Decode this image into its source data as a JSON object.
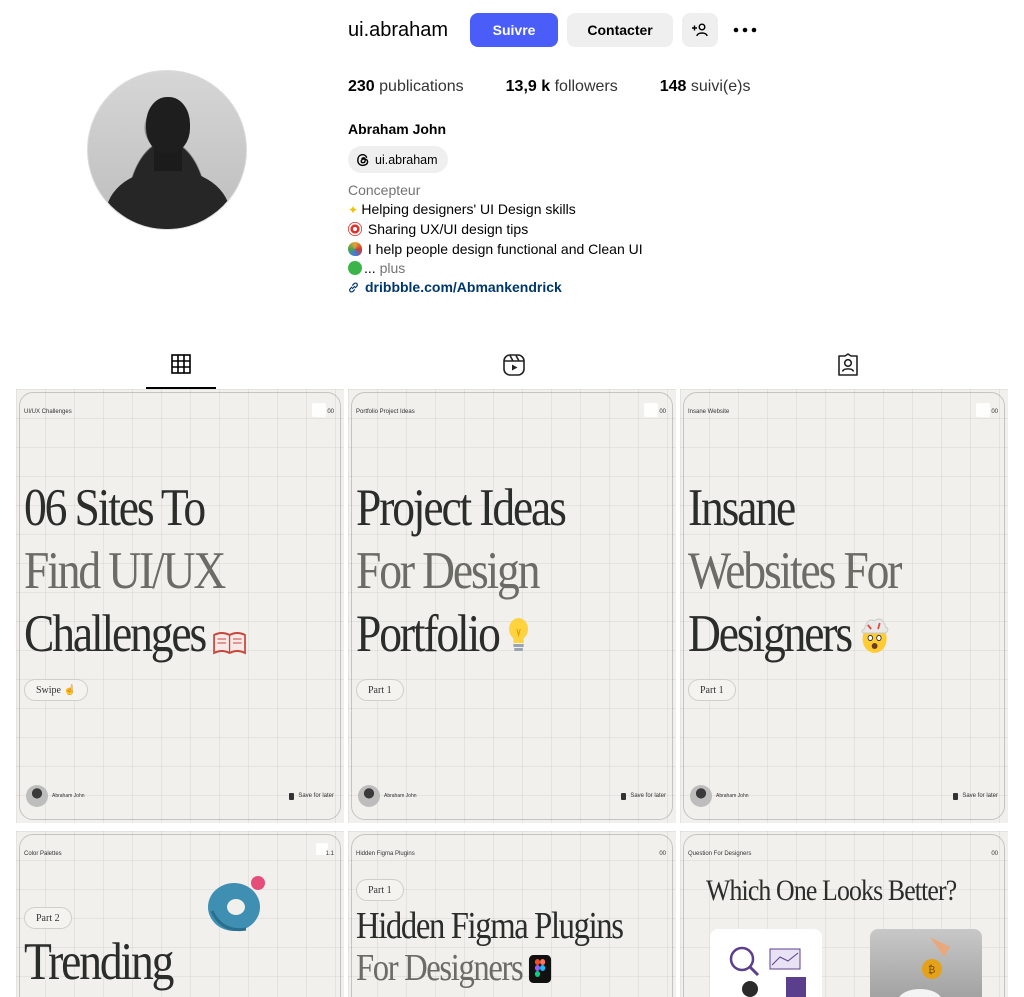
{
  "profile": {
    "username": "ui.abraham",
    "follow_label": "Suivre",
    "contact_label": "Contacter",
    "add_user_icon": "add-user-icon",
    "more_icon": "more-icon",
    "stats": {
      "posts_count": "230",
      "posts_label": "publications",
      "followers_count": "13,9 k",
      "followers_label": "followers",
      "following_count": "148",
      "following_label": "suivi(e)s"
    },
    "full_name": "Abraham John",
    "threads_handle": "ui.abraham",
    "category": "Concepteur",
    "bio_lines": [
      "Helping designers' UI Design skills",
      "Sharing UX/UI design tips",
      "I help people design functional and Clean UI"
    ],
    "bio_truncation": "...",
    "more_label": "plus",
    "link": "dribbble.com/Abmankendrick"
  },
  "tabs": [
    {
      "name": "posts",
      "icon": "grid-icon",
      "active": true
    },
    {
      "name": "reels",
      "icon": "reels-icon",
      "active": false
    },
    {
      "name": "tagged",
      "icon": "tagged-icon",
      "active": false
    }
  ],
  "posts": [
    {
      "tag": "UI/UX Challenges",
      "num": "00",
      "line1": "06 Sites To",
      "line2": "Find UI/UX",
      "line3": "Challenges",
      "chip": "Swipe",
      "author": "Abraham John",
      "save": "Save for later"
    },
    {
      "tag": "Portfolio Project Ideas",
      "num": "00",
      "line1": "Project Ideas",
      "line2": "For Design",
      "line3": "Portfolio",
      "chip": "Part 1",
      "author": "Abraham John",
      "save": "Save for later"
    },
    {
      "tag": "Insane Website",
      "num": "00",
      "line1": "Insane",
      "line2": "Websites For",
      "line3": "Designers",
      "chip": "Part 1",
      "author": "Abraham John",
      "save": "Save for later"
    },
    {
      "tag": "Color Palettes",
      "num": "1.1",
      "chip": "Part 2",
      "line1": "Trending"
    },
    {
      "tag": "Hidden Figma Plugins",
      "num": "00",
      "chip": "Part 1",
      "line1": "Hidden Figma Plugins",
      "line2": "For Designers"
    },
    {
      "tag": "Question For Designers",
      "num": "00",
      "line1": "Which One Looks Better?"
    }
  ],
  "colors": {
    "accent": "#4a5df9",
    "link": "#00376b",
    "card_bg": "#f1f0ec"
  }
}
